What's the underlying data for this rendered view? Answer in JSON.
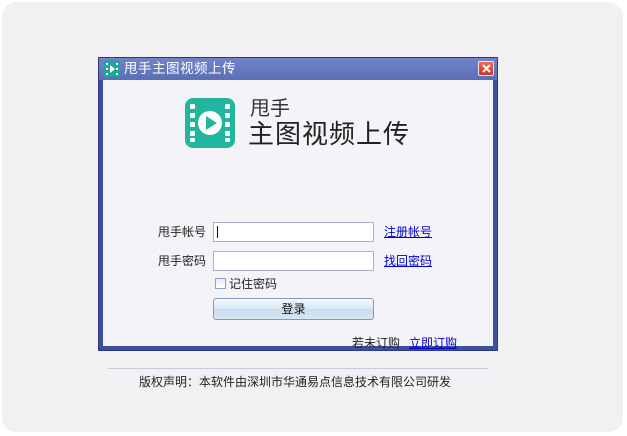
{
  "window": {
    "title": "甩手主图视频上传",
    "icon": "video-app-icon",
    "close_icon": "close-icon"
  },
  "brand": {
    "line1": "甩手",
    "line2": "主图视频上传",
    "logo_icon": "film-play-icon",
    "logo_color": "#24b59f"
  },
  "login": {
    "account_label": "甩手帐号",
    "account_value": "",
    "register_link": "注册帐号",
    "password_label": "甩手密码",
    "password_value": "",
    "recover_link": "找回密码",
    "remember_label": "记住密码",
    "remember_checked": false,
    "login_button": "登录"
  },
  "purchase": {
    "prompt": "若未订购",
    "link": "立即订购"
  },
  "footer": {
    "copyright": "版权声明：本软件由深圳市华通易点信息技术有限公司研发"
  },
  "colors": {
    "titlebar": "#6f85c8",
    "link": "#0000cc",
    "close": "#c8352a"
  }
}
